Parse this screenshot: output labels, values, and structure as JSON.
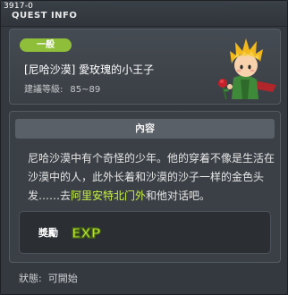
{
  "window": {
    "quest_id": "3917-0",
    "title": "QUEST INFO"
  },
  "quest": {
    "category": "一般",
    "title": "[尼哈沙漠] 愛玫瑰的小王子",
    "level_label": "建議等級:",
    "level_range": "85~89"
  },
  "content": {
    "header": "內容",
    "desc_part1": "尼哈沙漠中有个奇怪的少年。他的穿着不像是生活在沙漠中的人，此外长着和沙漠的沙子一样的金色头发……去",
    "desc_highlight": "阿里安特北门外",
    "desc_part2": "和他对话吧。",
    "highlight_color": "#c8f04a"
  },
  "reward": {
    "label": "獎勵",
    "icon": "exp-icon",
    "icon_text": "EXP"
  },
  "status": {
    "label": "狀態:",
    "value": "可開始"
  },
  "colors": {
    "badge": "#8fbf3a",
    "window_bg": "#34393f",
    "panel_header": "#5a6067"
  }
}
